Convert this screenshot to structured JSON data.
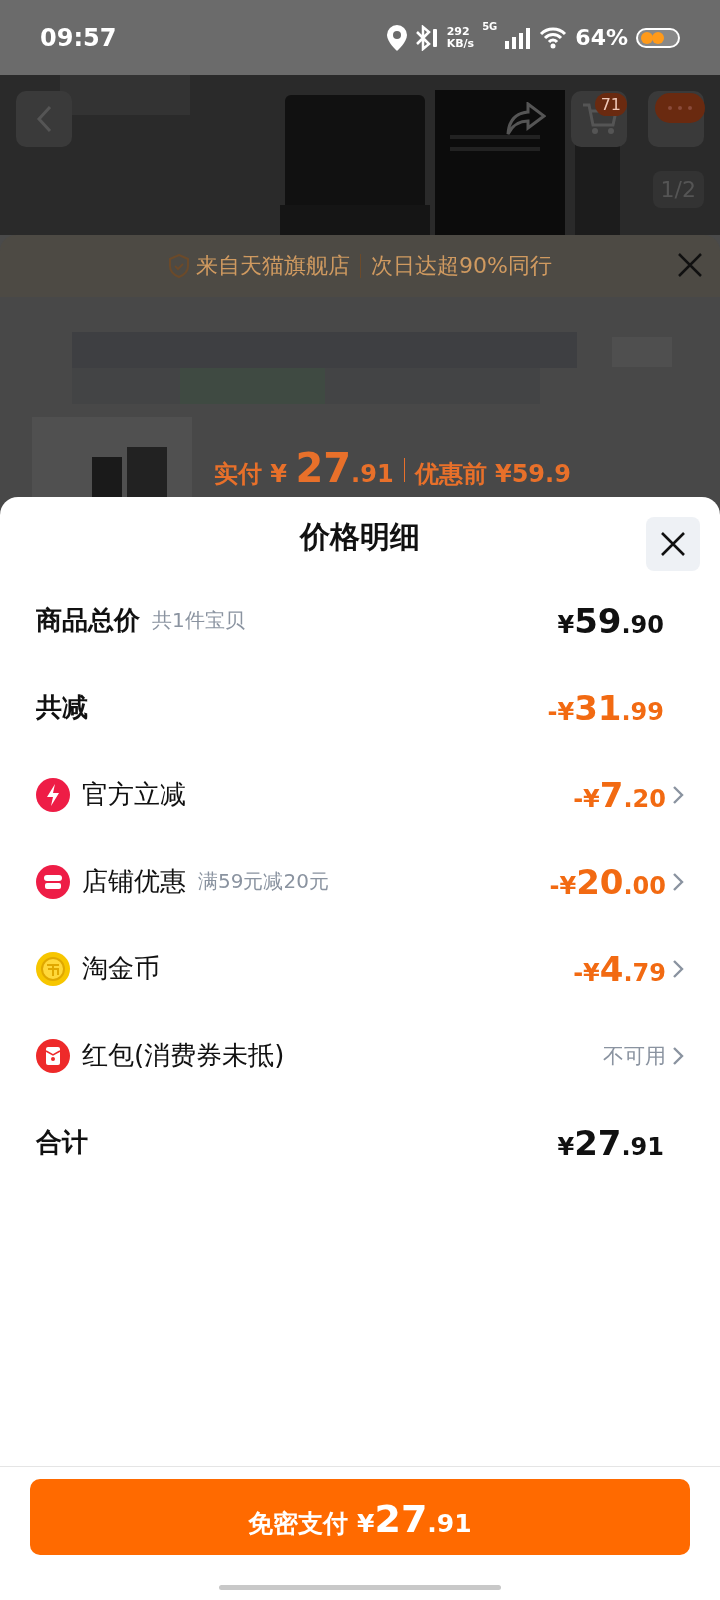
{
  "status_bar": {
    "time": "09:57",
    "net_speed": "292",
    "net_unit": "KB/s",
    "network": "5G",
    "battery": "64%"
  },
  "product_page": {
    "cart_count": "71",
    "pager": "1/2",
    "banner": "来自天猫旗舰店",
    "banner_extra": "次日达超90%同行",
    "price_label": "实付",
    "price_currency": "¥",
    "price_integer": "27",
    "price_decimal": ".91",
    "before_label": "优惠前",
    "before_price": "¥59.9"
  },
  "sheet": {
    "title": "价格明细",
    "rows": [
      {
        "kind": "plain",
        "label": "商品总价",
        "note": "共1件宝贝",
        "value": "¥59.90",
        "discount": false,
        "link": false
      },
      {
        "kind": "plain",
        "label": "共减",
        "value": "-¥31.99",
        "discount": true,
        "link": false
      },
      {
        "kind": "bolt",
        "label": "官方立减",
        "value": "-¥7.20",
        "discount": true,
        "link": true
      },
      {
        "kind": "store",
        "label": "店铺优惠",
        "note": "满59元减20元",
        "value": "-¥20.00",
        "discount": true,
        "link": true
      },
      {
        "kind": "coin",
        "label": "淘金币",
        "value": "-¥4.79",
        "discount": true,
        "link": true
      },
      {
        "kind": "redpacket",
        "label": "红包(消费券未抵)",
        "status": "不可用",
        "link": true
      },
      {
        "kind": "plain",
        "label": "合计",
        "value": "¥27.91",
        "discount": false,
        "link": false
      }
    ],
    "pay_button": {
      "label": "免密支付",
      "currency": "¥",
      "integer": "27",
      "decimal": ".91"
    }
  }
}
